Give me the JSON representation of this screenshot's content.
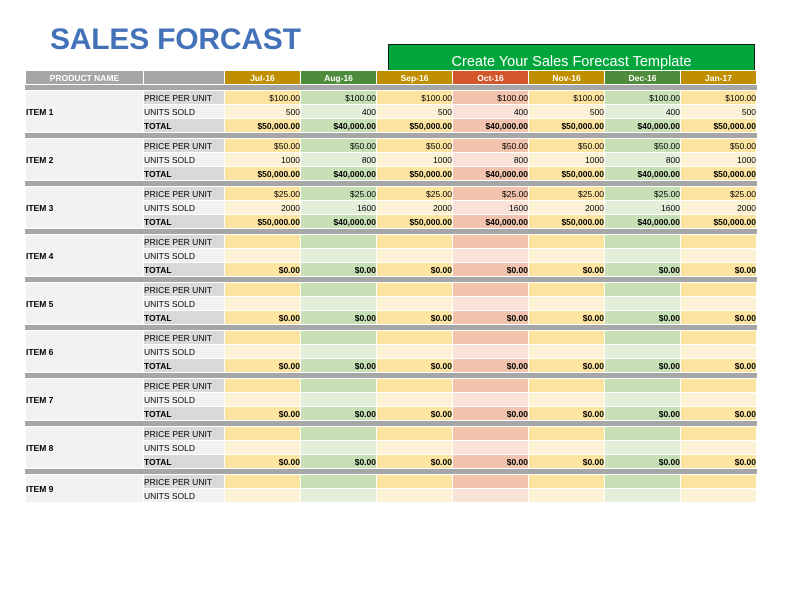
{
  "header": {
    "title": "SALES FORCAST",
    "cta_label": "Create Your Sales Forecast Template",
    "title_color": "#4472b8",
    "cta_bg": "#00a63c"
  },
  "table": {
    "product_column_header": "PRODUCT NAME",
    "sub_labels": {
      "price": "PRICE PER UNIT",
      "units": "UNITS SOLD",
      "total": "TOTAL"
    },
    "months": [
      {
        "label": "Jul-16",
        "header_bg": "#bf8f00",
        "tone": "gold"
      },
      {
        "label": "Aug-16",
        "header_bg": "#4e8b3a",
        "tone": "green"
      },
      {
        "label": "Sep-16",
        "header_bg": "#bf8f00",
        "tone": "gold"
      },
      {
        "label": "Oct-16",
        "header_bg": "#d2562a",
        "tone": "red"
      },
      {
        "label": "Nov-16",
        "header_bg": "#bf8f00",
        "tone": "gold"
      },
      {
        "label": "Dec-16",
        "header_bg": "#4e8b3a",
        "tone": "green"
      },
      {
        "label": "Jan-17",
        "header_bg": "#bf8f00",
        "tone": "gold"
      }
    ],
    "items": [
      {
        "name": "ITEM 1",
        "price": [
          "$100.00",
          "$100.00",
          "$100.00",
          "$100.00",
          "$100.00",
          "$100.00",
          "$100.00"
        ],
        "units": [
          "500",
          "400",
          "500",
          "400",
          "500",
          "400",
          "500"
        ],
        "total": [
          "$50,000.00",
          "$40,000.00",
          "$50,000.00",
          "$40,000.00",
          "$50,000.00",
          "$40,000.00",
          "$50,000.00"
        ]
      },
      {
        "name": "ITEM 2",
        "price": [
          "$50.00",
          "$50.00",
          "$50.00",
          "$50.00",
          "$50.00",
          "$50.00",
          "$50.00"
        ],
        "units": [
          "1000",
          "800",
          "1000",
          "800",
          "1000",
          "800",
          "1000"
        ],
        "total": [
          "$50,000.00",
          "$40,000.00",
          "$50,000.00",
          "$40,000.00",
          "$50,000.00",
          "$40,000.00",
          "$50,000.00"
        ]
      },
      {
        "name": "ITEM 3",
        "price": [
          "$25.00",
          "$25.00",
          "$25.00",
          "$25.00",
          "$25.00",
          "$25.00",
          "$25.00"
        ],
        "units": [
          "2000",
          "1600",
          "2000",
          "1600",
          "2000",
          "1600",
          "2000"
        ],
        "total": [
          "$50,000.00",
          "$40,000.00",
          "$50,000.00",
          "$40,000.00",
          "$50,000.00",
          "$40,000.00",
          "$50,000.00"
        ]
      },
      {
        "name": "ITEM 4",
        "price": [
          "",
          "",
          "",
          "",
          "",
          "",
          ""
        ],
        "units": [
          "",
          "",
          "",
          "",
          "",
          "",
          ""
        ],
        "total": [
          "$0.00",
          "$0.00",
          "$0.00",
          "$0.00",
          "$0.00",
          "$0.00",
          "$0.00"
        ]
      },
      {
        "name": "ITEM 5",
        "price": [
          "",
          "",
          "",
          "",
          "",
          "",
          ""
        ],
        "units": [
          "",
          "",
          "",
          "",
          "",
          "",
          ""
        ],
        "total": [
          "$0.00",
          "$0.00",
          "$0.00",
          "$0.00",
          "$0.00",
          "$0.00",
          "$0.00"
        ]
      },
      {
        "name": "ITEM 6",
        "price": [
          "",
          "",
          "",
          "",
          "",
          "",
          ""
        ],
        "units": [
          "",
          "",
          "",
          "",
          "",
          "",
          ""
        ],
        "total": [
          "$0.00",
          "$0.00",
          "$0.00",
          "$0.00",
          "$0.00",
          "$0.00",
          "$0.00"
        ]
      },
      {
        "name": "ITEM 7",
        "price": [
          "",
          "",
          "",
          "",
          "",
          "",
          ""
        ],
        "units": [
          "",
          "",
          "",
          "",
          "",
          "",
          ""
        ],
        "total": [
          "$0.00",
          "$0.00",
          "$0.00",
          "$0.00",
          "$0.00",
          "$0.00",
          "$0.00"
        ]
      },
      {
        "name": "ITEM 8",
        "price": [
          "",
          "",
          "",
          "",
          "",
          "",
          ""
        ],
        "units": [
          "",
          "",
          "",
          "",
          "",
          "",
          ""
        ],
        "total": [
          "$0.00",
          "$0.00",
          "$0.00",
          "$0.00",
          "$0.00",
          "$0.00",
          "$0.00"
        ]
      },
      {
        "name": "ITEM 9",
        "clipped": true,
        "price": [
          "",
          "",
          "",
          "",
          "",
          "",
          ""
        ],
        "units": [
          "",
          "",
          "",
          "",
          "",
          "",
          ""
        ],
        "total": [
          "",
          "",
          "",
          "",
          "",
          "",
          ""
        ]
      }
    ]
  }
}
